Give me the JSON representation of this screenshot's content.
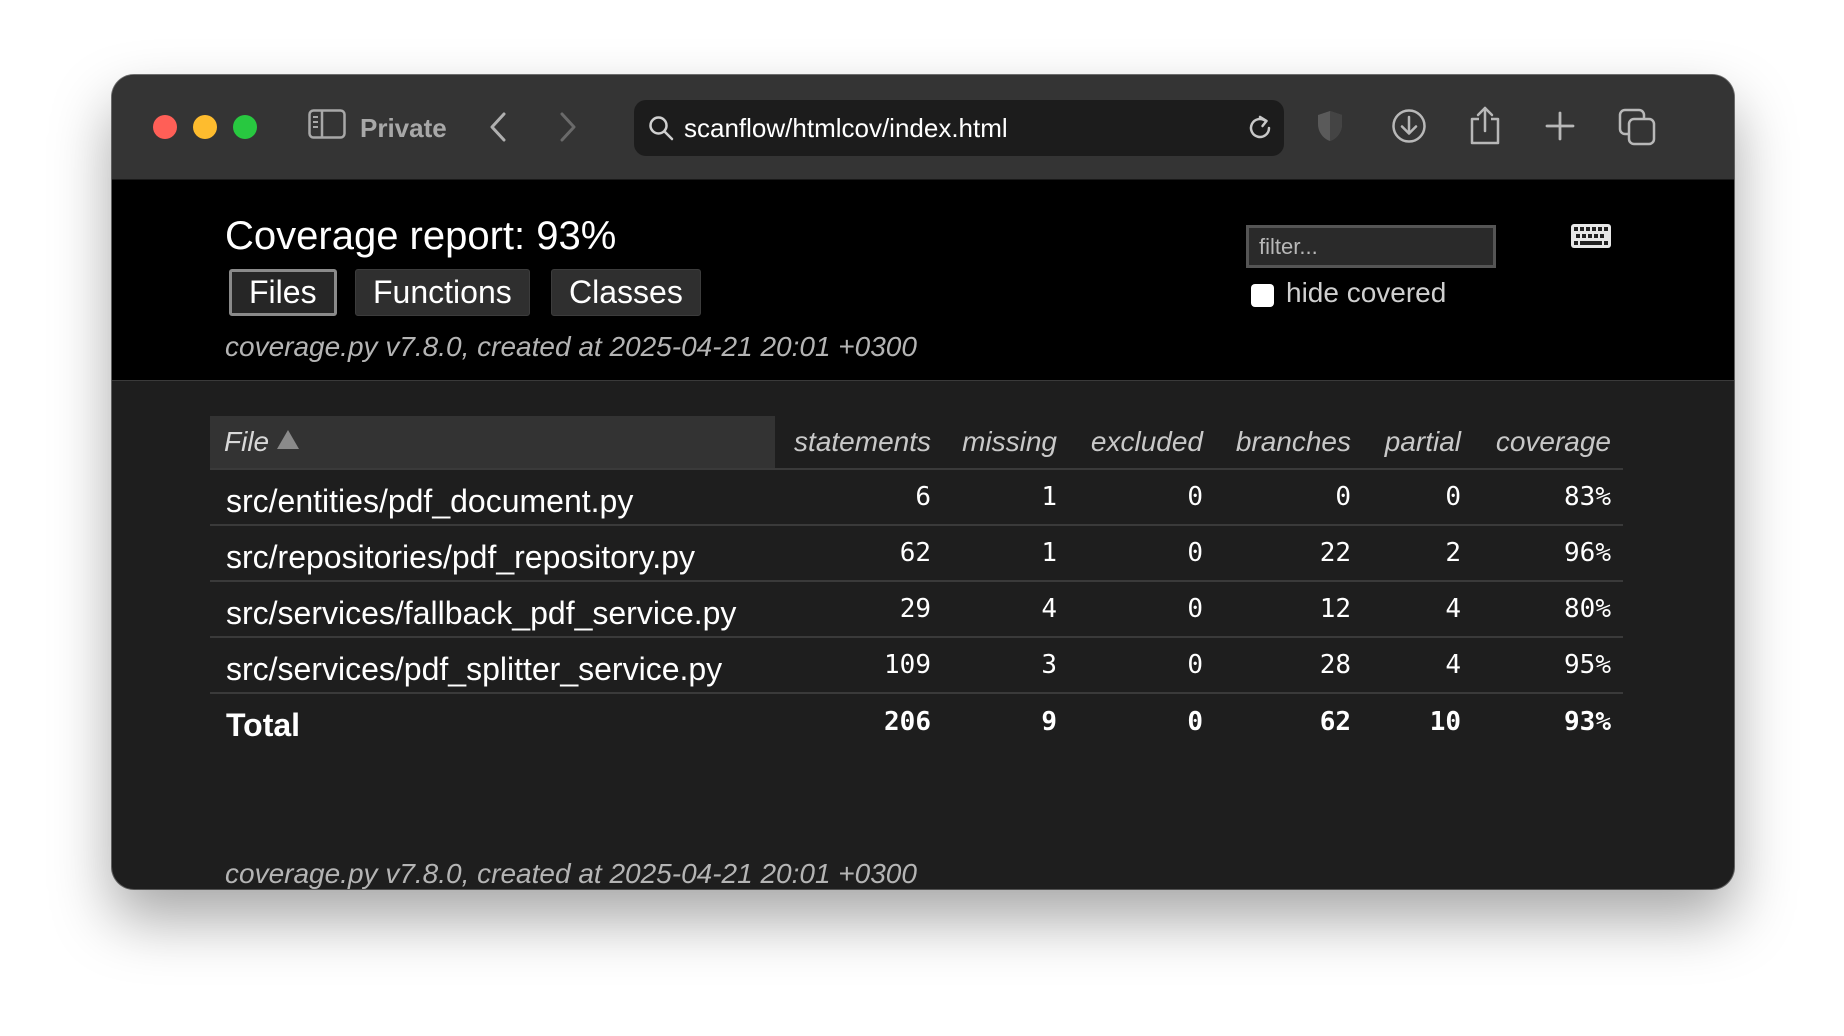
{
  "browser": {
    "private_label": "Private",
    "url": "scanflow/htmlcov/index.html"
  },
  "report": {
    "title": "Coverage report: 93%",
    "tabs": [
      "Files",
      "Functions",
      "Classes"
    ],
    "active_tab": "Files",
    "filter_placeholder": "filter...",
    "hide_covered_label": "hide covered",
    "hide_covered_checked": false,
    "meta": "coverage.py v7.8.0, created at 2025-04-21 20:01 +0300"
  },
  "table": {
    "columns": [
      "File",
      "statements",
      "missing",
      "excluded",
      "branches",
      "partial",
      "coverage"
    ],
    "sort": {
      "column": "File",
      "direction": "ascending"
    },
    "rows": [
      [
        "src/entities/pdf_document.py",
        "6",
        "1",
        "0",
        "0",
        "0",
        "83%"
      ],
      [
        "src/repositories/pdf_repository.py",
        "62",
        "1",
        "0",
        "22",
        "2",
        "96%"
      ],
      [
        "src/services/fallback_pdf_service.py",
        "29",
        "4",
        "0",
        "12",
        "4",
        "80%"
      ],
      [
        "src/services/pdf_splitter_service.py",
        "109",
        "3",
        "0",
        "28",
        "4",
        "95%"
      ]
    ],
    "total": [
      "Total",
      "206",
      "9",
      "0",
      "62",
      "10",
      "93%"
    ]
  },
  "colors": {
    "header_bg": "#000000",
    "body_bg": "#1e1e1e",
    "toolbar_bg": "#343434",
    "traffic_red": "#ff5f57",
    "traffic_yellow": "#febc2e",
    "traffic_green": "#28c840"
  },
  "icons": [
    "sidebar-icon",
    "back-icon",
    "forward-icon",
    "search-icon",
    "reload-icon",
    "shield-icon",
    "download-icon",
    "share-icon",
    "new-tab-icon",
    "tab-overview-icon",
    "keyboard-icon",
    "sort-ascending-icon"
  ]
}
